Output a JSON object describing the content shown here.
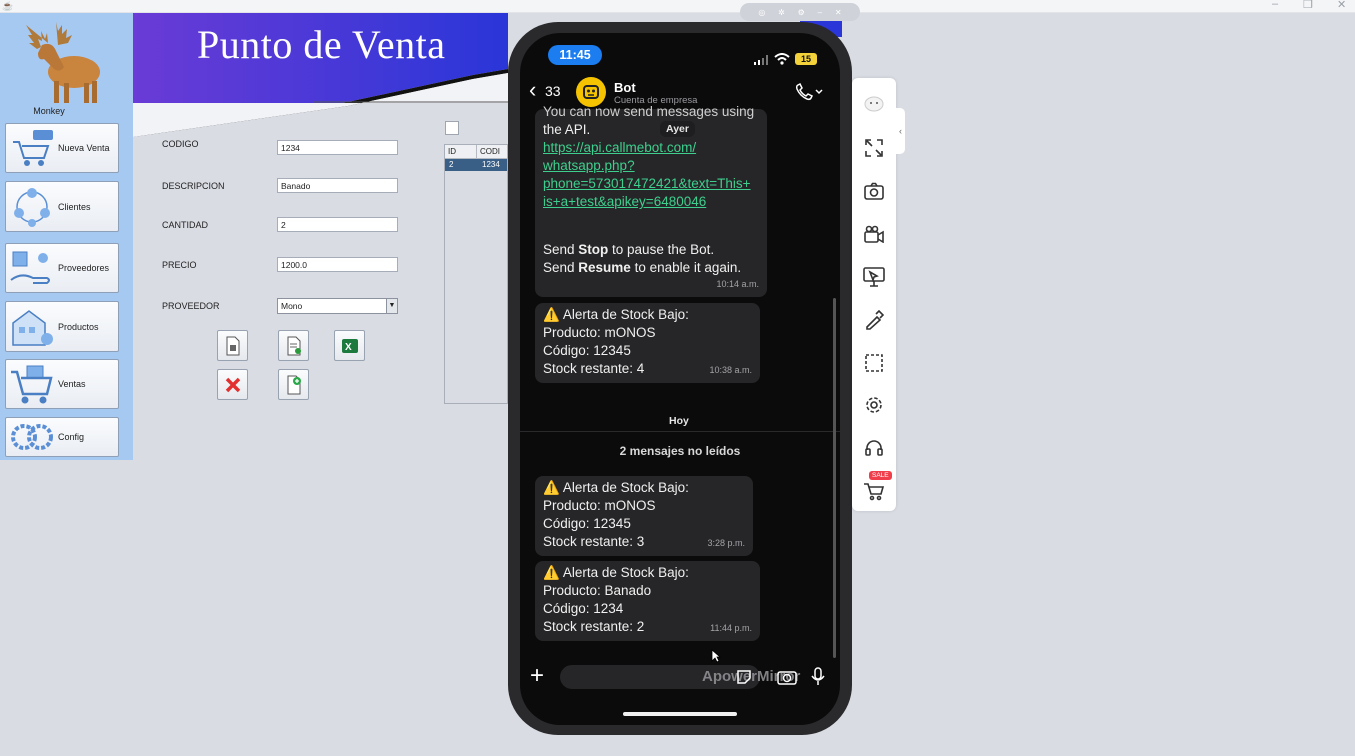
{
  "window": {
    "minimize": "–",
    "restore": "❐",
    "close": "✕"
  },
  "sidebar": {
    "logo_label": "Monkey",
    "items": [
      {
        "label": "Nueva Venta"
      },
      {
        "label": "Clientes"
      },
      {
        "label": "Proveedores"
      },
      {
        "label": "Productos"
      },
      {
        "label": "Ventas"
      },
      {
        "label": "Config"
      }
    ]
  },
  "header": {
    "title": "Punto de Venta"
  },
  "form": {
    "codigo_label": "CODIGO",
    "codigo_value": "1234",
    "descripcion_label": "DESCRIPCION",
    "descripcion_value": "Banado",
    "cantidad_label": "CANTIDAD",
    "cantidad_value": "2",
    "precio_label": "PRECIO",
    "precio_value": "1200.0",
    "proveedor_label": "PROVEEDOR",
    "proveedor_value": "Mono"
  },
  "table": {
    "columns": [
      "ID",
      "CODI"
    ],
    "rows": [
      [
        "2",
        "1234"
      ]
    ]
  },
  "phone": {
    "time": "11:45",
    "battery": "15",
    "back_count": "33",
    "contact_name": "Bot",
    "contact_sub": "Cuenta de empresa",
    "day_ayer": "Ayer",
    "day_hoy": "Hoy",
    "unread": "2 mensajes no leídos",
    "msg1": {
      "line1": "You can now send messages using",
      "line2": "the API.",
      "link1": "https://api.callmebot.com/",
      "link2": "whatsapp.php?",
      "link3": "phone=573017472421&text=This+",
      "link4": "is+a+test&apikey=6480046",
      "p1_pre": "Send ",
      "p1_bold": "Stop",
      "p1_post": " to pause the Bot.",
      "p2_pre": "Send ",
      "p2_bold": "Resume",
      "p2_post": " to enable it again.",
      "time": "10:14 a.m."
    },
    "alerts": [
      {
        "title": "Alerta de Stock Bajo:",
        "producto": "Producto: mONOS",
        "codigo": "Código: 12345",
        "stock": "Stock restante: 4",
        "time": "10:38 a.m."
      },
      {
        "title": "Alerta de Stock Bajo:",
        "producto": "Producto: mONOS",
        "codigo": "Código: 12345",
        "stock": "Stock restante: 3",
        "time": "3:28 p.m."
      },
      {
        "title": "Alerta de Stock Bajo:",
        "producto": "Producto: Banado",
        "codigo": "Código: 1234",
        "stock": "Stock restante: 2",
        "time": "11:44 p.m."
      }
    ],
    "watermark": "ApowerMirror"
  },
  "toolbar": {
    "sale_badge": "SALE"
  },
  "colors": {
    "sidebar_bg": "#a6c9f2",
    "header_blue": "#2a36d8",
    "header_purple": "#6a3bd6",
    "whatsapp_link": "#3ecf8e",
    "avatar_yellow": "#f5c300"
  }
}
